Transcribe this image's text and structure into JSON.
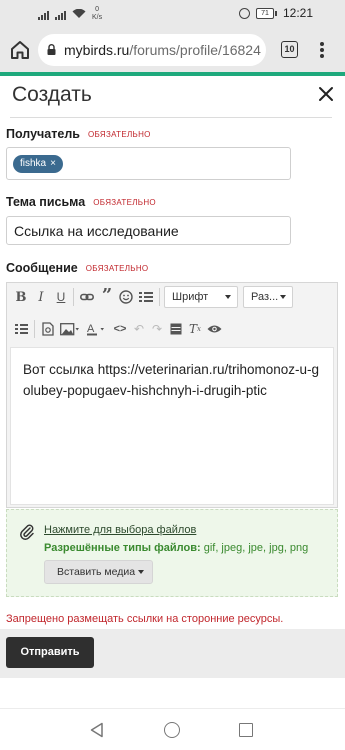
{
  "status_bar": {
    "net_speed_value": "0",
    "net_speed_unit": "K/s",
    "battery": "71",
    "time": "12:21"
  },
  "browser": {
    "url_host": "mybirds.ru",
    "url_path": "/forums/profile/16824",
    "tab_count": "10"
  },
  "form": {
    "title": "Создать",
    "required_text": "ОБЯЗАТЕЛЬНО",
    "recipient": {
      "label": "Получатель",
      "tags": [
        {
          "name": "fishka",
          "remove": "×"
        }
      ]
    },
    "subject": {
      "label": "Тема письма",
      "value": "Ссылка на исследование"
    },
    "message": {
      "label": "Сообщение",
      "body": "Вот ссылка https://veterinarian.ru/trihomonoz-u-golubey-popugaev-hishchnyh-i-drugih-ptic"
    },
    "editor": {
      "font_dropdown": "Шрифт",
      "size_dropdown": "Раз..."
    },
    "attach": {
      "link_text": "Нажмите для выбора файлов",
      "types_label": "Разрешённые типы файлов:",
      "types_value": "gif, jpeg, jpe, jpg, png",
      "insert_media": "Вставить медиа"
    },
    "error": "Запрещено размещать ссылки на сторонние ресурсы.",
    "submit": "Отправить"
  },
  "colors": {
    "accent": "#1ea97c",
    "required": "#c1272d",
    "tag_bg": "#3b6a8f",
    "submit_bg": "#2f2f2f",
    "attach_bg": "#eef7ea"
  }
}
